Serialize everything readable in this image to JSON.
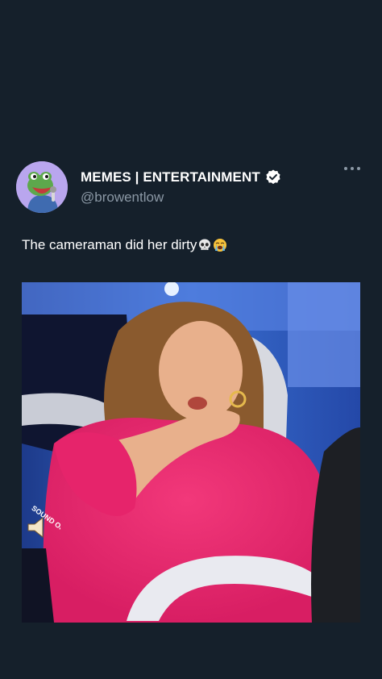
{
  "tweet": {
    "author": {
      "display_name": "MEMES | ENTERTAINMENT",
      "handle": "@browentlow",
      "verified": true,
      "avatar_icon": "frog-avatar-icon"
    },
    "text": "The cameraman did her dirty",
    "emojis": [
      "skull-emoji",
      "loudly-crying-face-emoji"
    ],
    "more_icon": "more-dots-icon",
    "media": {
      "type": "video",
      "badge": "SOUND ON"
    }
  },
  "colors": {
    "background": "#15202b",
    "primary_text": "#ffffff",
    "secondary_text": "#8b98a5",
    "verified_badge": "#ffffff"
  }
}
